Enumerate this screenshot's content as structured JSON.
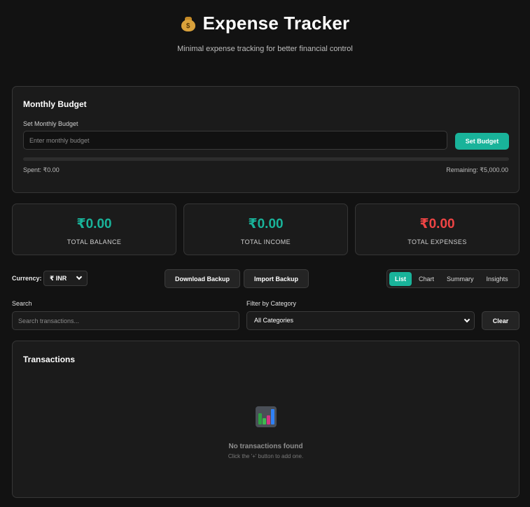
{
  "header": {
    "title": "Expense Tracker",
    "subtitle": "Minimal expense tracking for better financial control",
    "icon": "money-bag-icon",
    "icon_symbol": "$"
  },
  "budget": {
    "title": "Monthly Budget",
    "input_label": "Set Monthly Budget",
    "input_placeholder": "Enter monthly budget",
    "input_value": "",
    "set_button": "Set Budget",
    "progress_fraction": 0,
    "spent": "Spent: ₹0.00",
    "remaining": "Remaining: ₹5,000.00"
  },
  "stats": [
    {
      "value": "₹0.00",
      "label": "TOTAL BALANCE",
      "color": "#19b39a"
    },
    {
      "value": "₹0.00",
      "label": "TOTAL INCOME",
      "color": "#19b39a"
    },
    {
      "value": "₹0.00",
      "label": "TOTAL EXPENSES",
      "color": "#ef4444"
    }
  ],
  "toolbar": {
    "currency_label": "Currency:",
    "currency_value": "₹ INR",
    "download_button": "Download Backup",
    "import_button": "Import Backup",
    "views": [
      "List",
      "Chart",
      "Summary",
      "Insights"
    ],
    "active_view": "List"
  },
  "filters": {
    "search_label": "Search",
    "search_placeholder": "Search transactions...",
    "category_label": "Filter by Category",
    "category_value": "All Categories",
    "clear_button": "Clear"
  },
  "transactions": {
    "title": "Transactions",
    "empty_icon": "bar-chart-icon",
    "empty_title": "No transactions found",
    "empty_subtitle": "Click the '+' button to add one."
  },
  "colors": {
    "accent": "#19b39a",
    "danger": "#ef4444",
    "background": "#121212",
    "card": "#1b1b1b"
  }
}
